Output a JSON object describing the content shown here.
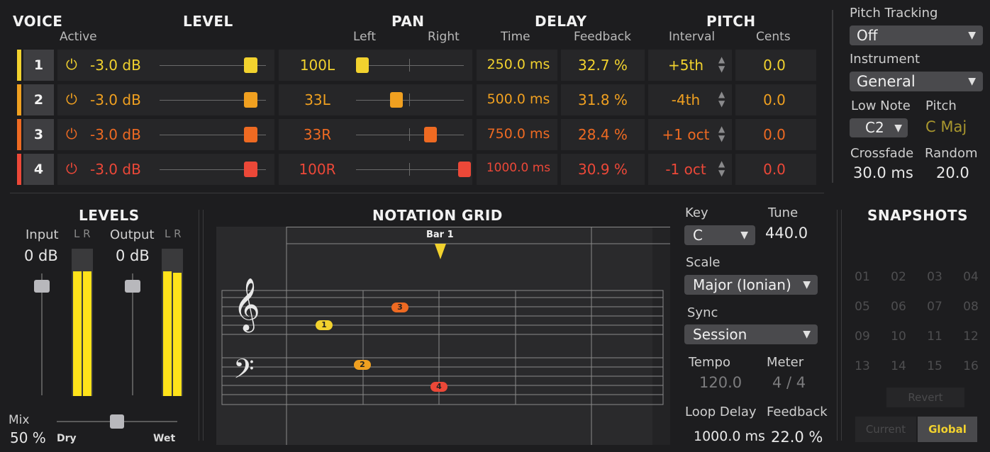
{
  "headers": {
    "voice": "VOICE",
    "level": "LEVEL",
    "pan": "PAN",
    "delay": "DELAY",
    "pitch": "PITCH"
  },
  "subheaders": {
    "active": "Active",
    "left": "Left",
    "right": "Right",
    "time": "Time",
    "feedback": "Feedback",
    "interval": "Interval",
    "cents": "Cents"
  },
  "voices": [
    {
      "num": "1",
      "level": "-3.0 dB",
      "level_frac": 0.85,
      "pan": "100L",
      "pan_frac": 0.0,
      "time": "250.0 ms",
      "feedback": "32.7 %",
      "interval": "+5th",
      "cents": "0.0",
      "color": "#f2d22e"
    },
    {
      "num": "2",
      "level": "-3.0 dB",
      "level_frac": 0.85,
      "pan": "33L",
      "pan_frac": 0.33,
      "time": "500.0 ms",
      "feedback": "31.8 %",
      "interval": "-4th",
      "cents": "0.0",
      "color": "#f0a020"
    },
    {
      "num": "3",
      "level": "-3.0 dB",
      "level_frac": 0.85,
      "pan": "33R",
      "pan_frac": 0.67,
      "time": "750.0 ms",
      "feedback": "28.4 %",
      "interval": "+1 oct",
      "cents": "0.0",
      "color": "#ee6a22"
    },
    {
      "num": "4",
      "level": "-3.0 dB",
      "level_frac": 0.85,
      "pan": "100R",
      "pan_frac": 1.0,
      "time": "1000.0 ms",
      "feedback": "30.9 %",
      "interval": "-1 oct",
      "cents": "0.0",
      "color": "#ec4838"
    }
  ],
  "right_panel": {
    "pitch_tracking_label": "Pitch Tracking",
    "pitch_tracking_value": "Off",
    "instrument_label": "Instrument",
    "instrument_value": "General",
    "low_note_label": "Low Note",
    "low_note_value": "C2",
    "pitch_label": "Pitch",
    "pitch_value": "C Maj",
    "crossfade_label": "Crossfade",
    "crossfade_value": "30.0 ms",
    "random_label": "Random",
    "random_value": "20.0"
  },
  "levels": {
    "title": "LEVELS",
    "input_label": "Input",
    "input_value": "0 dB",
    "output_label": "Output",
    "output_value": "0 dB",
    "lr": "L R",
    "mix_label": "Mix",
    "mix_value": "50 %",
    "dry": "Dry",
    "wet": "Wet",
    "mix_frac": 0.5,
    "input_meter": [
      0.95,
      0.95
    ],
    "output_meter": [
      0.95,
      0.94
    ]
  },
  "notation": {
    "title": "NOTATION GRID",
    "bar_label": "Bar 1",
    "notes": [
      {
        "n": "1",
        "color": "#f2d22e"
      },
      {
        "n": "2",
        "color": "#f0a020"
      },
      {
        "n": "3",
        "color": "#ee6a22"
      },
      {
        "n": "4",
        "color": "#ec4838"
      }
    ]
  },
  "settings": {
    "key_label": "Key",
    "key_value": "C",
    "tune_label": "Tune",
    "tune_value": "440.0",
    "scale_label": "Scale",
    "scale_value": "Major (Ionian)",
    "sync_label": "Sync",
    "sync_value": "Session",
    "tempo_label": "Tempo",
    "tempo_value": "120.0",
    "meter_label": "Meter",
    "meter_value": "4 / 4",
    "loop_delay_label": "Loop Delay",
    "loop_delay_value": "1000.0 ms",
    "feedback_label": "Feedback",
    "feedback_value": "22.0 %"
  },
  "snapshots": {
    "title": "SNAPSHOTS",
    "slots": [
      "01",
      "02",
      "03",
      "04",
      "05",
      "06",
      "07",
      "08",
      "09",
      "10",
      "11",
      "12",
      "13",
      "14",
      "15",
      "16"
    ],
    "revert": "Revert",
    "current": "Current",
    "global": "Global"
  },
  "icons": {
    "power": "power-icon",
    "updown": "up-down-arrow-icon",
    "dropdown": "chevron-down-icon",
    "treble": "treble-clef-icon",
    "bass": "bass-clef-icon",
    "playhead": "playhead-icon"
  }
}
